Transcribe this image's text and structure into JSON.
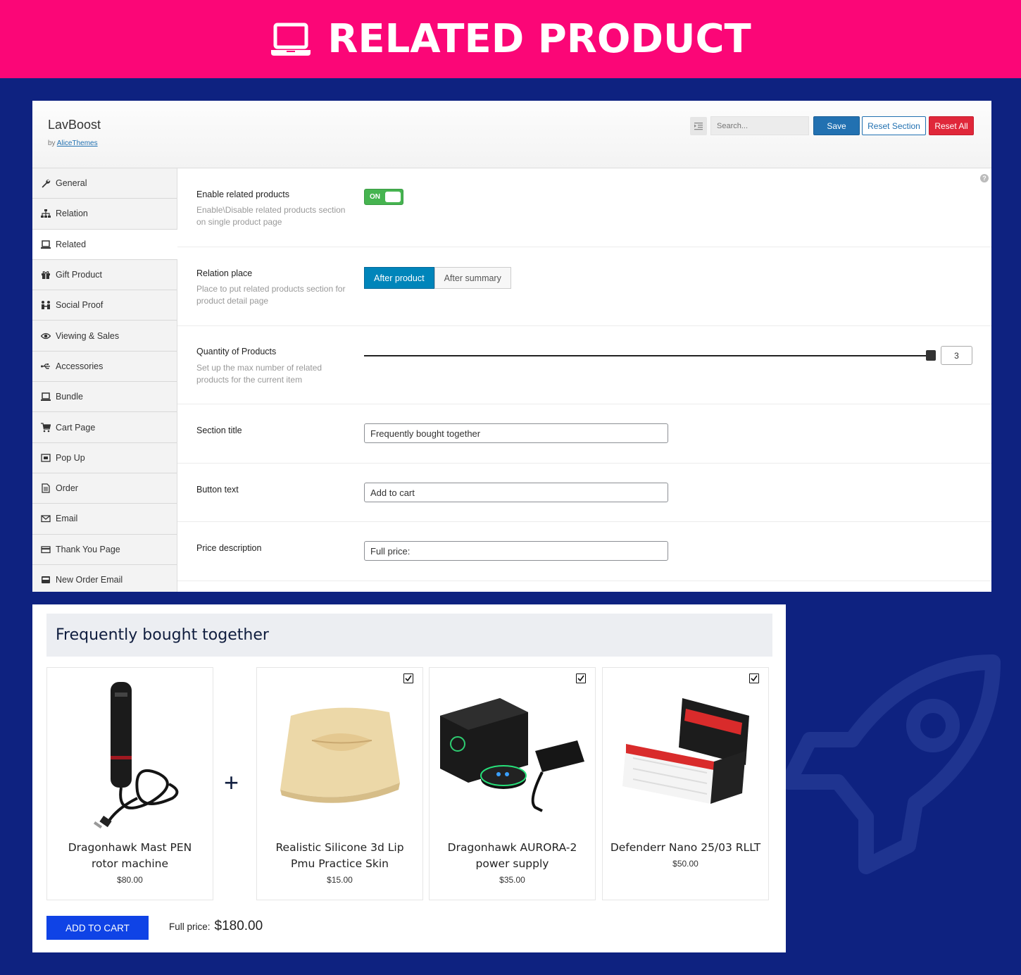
{
  "banner": {
    "title": "RELATED PRODUCT",
    "icon": "laptop-icon"
  },
  "header": {
    "brand": "LavBoost",
    "by_prefix": "by",
    "by_link": "AliceThemes",
    "search_placeholder": "Search...",
    "save_label": "Save",
    "reset_section_label": "Reset Section",
    "reset_all_label": "Reset All"
  },
  "sidebar": {
    "items": [
      {
        "label": "General",
        "icon": "wrench-icon"
      },
      {
        "label": "Relation",
        "icon": "sitemap-icon"
      },
      {
        "label": "Related",
        "icon": "laptop-icon"
      },
      {
        "label": "Gift Product",
        "icon": "gift-icon"
      },
      {
        "label": "Social Proof",
        "icon": "people-icon"
      },
      {
        "label": "Viewing & Sales",
        "icon": "eye-icon"
      },
      {
        "label": "Accessories",
        "icon": "usb-icon"
      },
      {
        "label": "Bundle",
        "icon": "laptop-icon"
      },
      {
        "label": "Cart Page",
        "icon": "cart-icon"
      },
      {
        "label": "Pop Up",
        "icon": "popup-icon"
      },
      {
        "label": "Order",
        "icon": "document-icon"
      },
      {
        "label": "Email",
        "icon": "envelope-icon"
      },
      {
        "label": "Thank You Page",
        "icon": "card-icon"
      },
      {
        "label": "New Order Email",
        "icon": "inbox-icon"
      }
    ],
    "active_index": 2
  },
  "settings": {
    "enable": {
      "label": "Enable related products",
      "desc": "Enable\\Disable related products section on single product page",
      "toggle_text": "ON",
      "value": true
    },
    "place": {
      "label": "Relation place",
      "desc": "Place to put related products section for product detail page",
      "options": [
        "After product",
        "After summary"
      ],
      "selected": "After product"
    },
    "quantity": {
      "label": "Quantity of Products",
      "desc": "Set up the max number of related products for the current item",
      "value": "3"
    },
    "section_title": {
      "label": "Section title",
      "value": "Frequently bought together"
    },
    "button_text": {
      "label": "Button text",
      "value": "Add to cart"
    },
    "price_desc": {
      "label": "Price description",
      "value": "Full price:"
    }
  },
  "preview": {
    "title": "Frequently bought together",
    "plus": "+",
    "products": [
      {
        "name": "Dragonhawk Mast PEN rotor machine",
        "price": "$80.00",
        "checkbox": false,
        "image": "tattoo-pen-image"
      },
      {
        "name": "Realistic Silicone 3d Lip Pmu Practice Skin",
        "price": "$15.00",
        "checkbox": true,
        "image": "silicone-lip-image"
      },
      {
        "name": "Dragonhawk AURORA-2 power supply",
        "price": "$35.00",
        "checkbox": true,
        "image": "power-supply-image"
      },
      {
        "name": "Defenderr Nano 25/03 RLLT",
        "price": "$50.00",
        "checkbox": true,
        "image": "needle-cartridge-image"
      }
    ],
    "button": "ADD TO CART",
    "full_price_label": "Full price:",
    "full_price_value": "$180.00"
  },
  "colors": {
    "banner": "#fb0677",
    "background": "#0e2280",
    "save": "#2271b1",
    "reset_all": "#e0273a",
    "toggle": "#46b450",
    "add_to_cart": "#0f43e6"
  }
}
